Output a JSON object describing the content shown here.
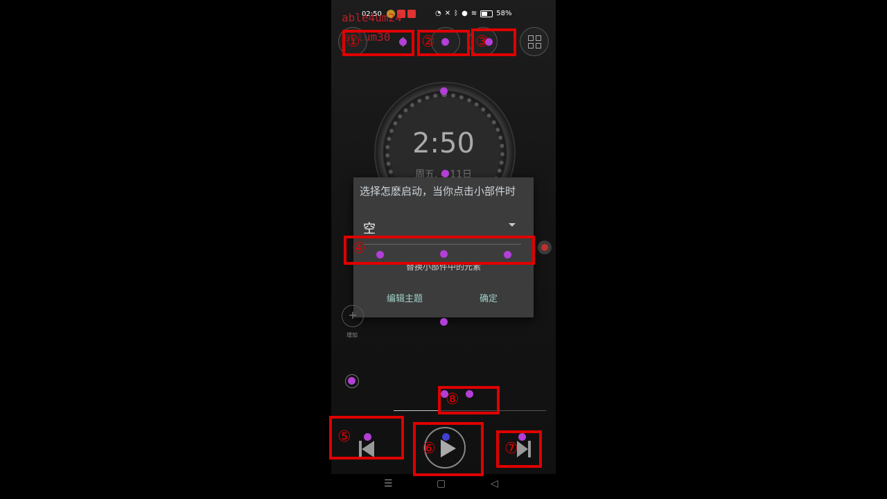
{
  "status_bar": {
    "time": "02:50",
    "battery": "58%"
  },
  "overlay_text": {
    "line1": "able4um24",
    "line2": "ablum30"
  },
  "clock": {
    "time": "2:50",
    "date": "周五, 4 11日"
  },
  "dialog": {
    "title": "选择怎麽启动，当你点击小部件时",
    "selected": "空",
    "hint": "替换小部件中的元素",
    "edit_theme": "编辑主题",
    "confirm": "确定"
  },
  "widgets": {
    "add_label": "增加",
    "add_symbol": "+"
  },
  "playback": {
    "progress": 0.3
  },
  "annotations": [
    "①",
    "②",
    "③",
    "④",
    "⑤",
    "⑥",
    "⑦",
    "⑧"
  ],
  "nav": {
    "menu": "☰",
    "home": "▢",
    "back": "◁"
  },
  "icons": {
    "bluetooth": "bluetooth-icon",
    "location": "location-icon",
    "wifi": "wifi-icon",
    "grid": "grid-icon"
  }
}
